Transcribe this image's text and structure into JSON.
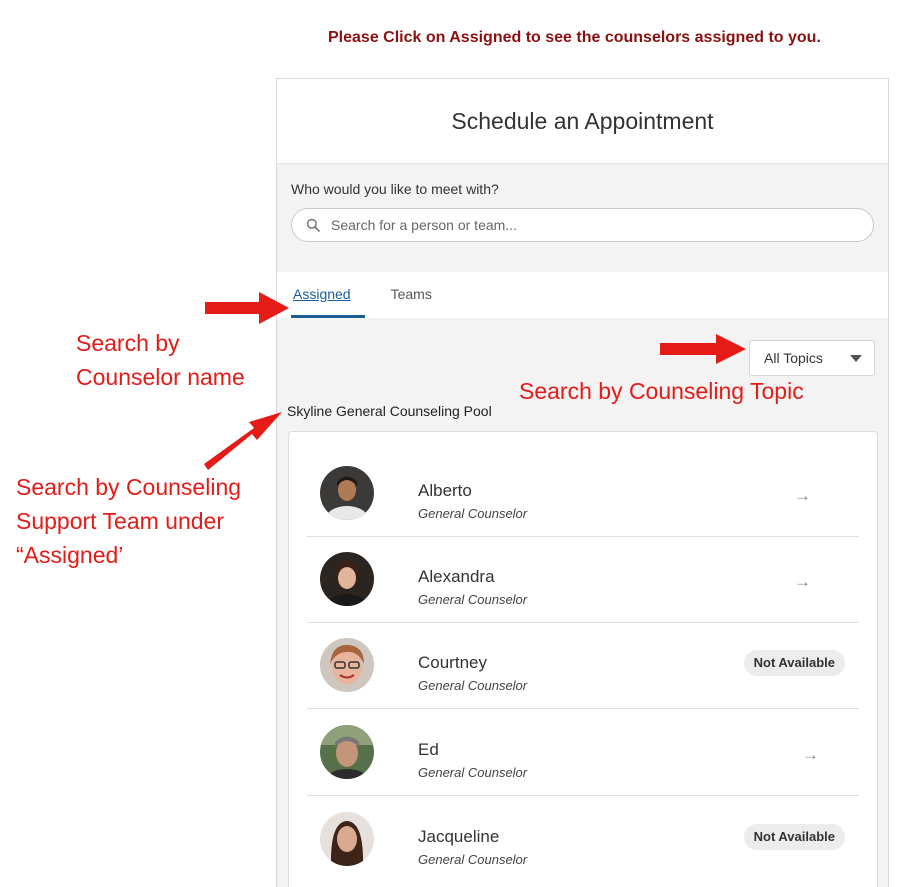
{
  "banner": "Please Click on Assigned to see the counselors assigned to you.",
  "panel": {
    "title": "Schedule an Appointment",
    "search_label": "Who would you like to meet with?",
    "search_placeholder": "Search for a person or team...",
    "tabs": [
      {
        "label": "Assigned",
        "active": true
      },
      {
        "label": "Teams",
        "active": false
      }
    ],
    "topic_filter": "All Topics",
    "pool_title": "Skyline General Counseling Pool",
    "counselors": [
      {
        "name": "Alberto",
        "role": "General Counselor",
        "status": "available",
        "arrow": "→"
      },
      {
        "name": "Alexandra",
        "role": "General Counselor",
        "status": "available",
        "arrow": "→"
      },
      {
        "name": "Courtney",
        "role": "General Counselor",
        "status": "Not Available"
      },
      {
        "name": "Ed",
        "role": "General Counselor",
        "status": "available",
        "arrow": "→"
      },
      {
        "name": "Jacqueline",
        "role": "General Counselor",
        "status": "Not Available"
      }
    ]
  },
  "annotations": {
    "counselor_name_line1": "Search by",
    "counselor_name_line2": "Counselor name",
    "topic": "Search by Counseling Topic",
    "team_line1": "Search by Counseling",
    "team_line2": "Support Team under",
    "team_line3": "“Assigned’"
  },
  "colors": {
    "banner": "#8b1111",
    "annotation": "#e41b17",
    "tab_active": "#1b5e9a",
    "panel_bg": "#f3f3f3"
  }
}
